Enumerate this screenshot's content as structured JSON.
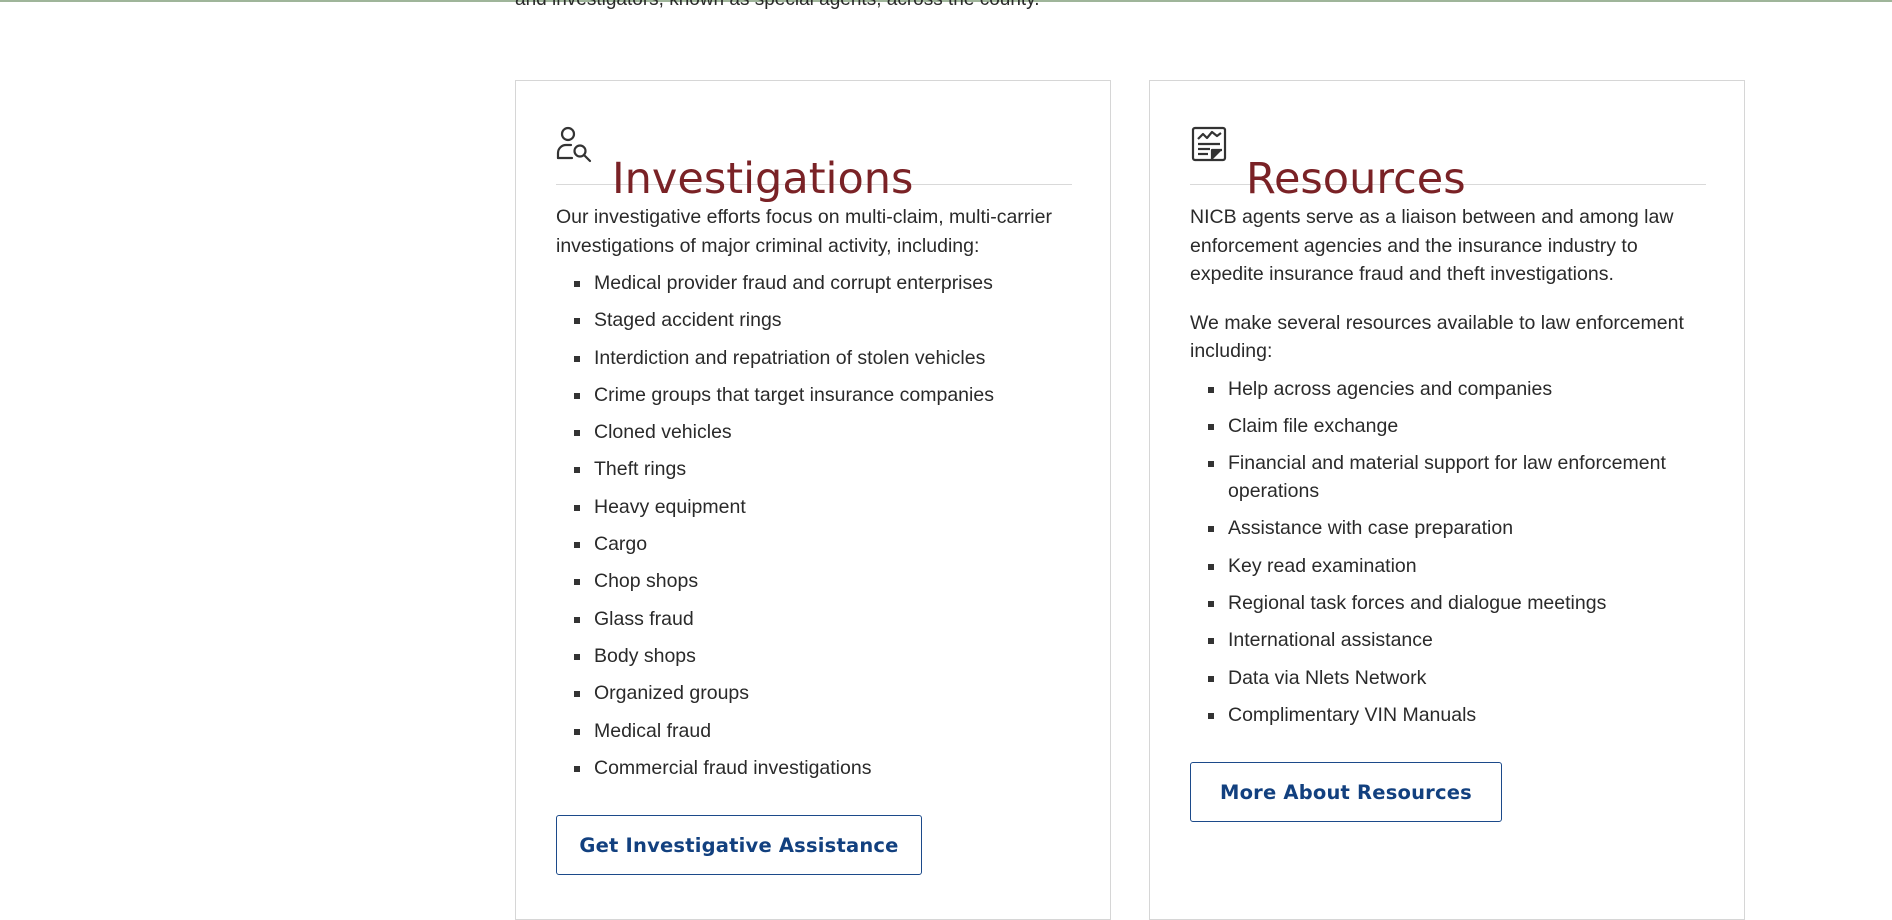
{
  "intro": {
    "text": "and investigators, known as special agents, across the county."
  },
  "investigations": {
    "icon": "person-search-icon",
    "title": "Investigations",
    "description": "Our investigative efforts focus on multi-claim, multi-carrier investigations of major criminal activity, including:",
    "items": [
      "Medical provider fraud and corrupt enterprises",
      "Staged accident rings",
      "Interdiction and repatriation of stolen vehicles",
      "Crime groups that target insurance companies",
      "Cloned vehicles",
      "Theft rings",
      "Heavy equipment",
      "Cargo",
      "Chop shops",
      "Glass fraud",
      "Body shops",
      "Organized groups",
      "Medical fraud",
      "Commercial fraud investigations"
    ],
    "button_label": "Get Investigative Assistance"
  },
  "resources": {
    "icon": "document-chart-icon",
    "title": "Resources",
    "description_1": "NICB agents serve as a liaison between and among law enforcement agencies and the insurance industry to expedite insurance fraud and theft investigations.",
    "description_2": "We make several resources available to law enforcement including:",
    "items": [
      "Help across agencies and companies",
      "Claim file exchange",
      "Financial and material support for law enforcement operations",
      "Assistance with case preparation",
      "Key read examination",
      "Regional task forces and dialogue meetings",
      "International assistance",
      "Data via Nlets Network",
      "Complimentary VIN Manuals"
    ],
    "button_label": "More About Resources"
  },
  "colors": {
    "title": "#7a2226",
    "button_text": "#12407f",
    "button_border": "#1c4a8a",
    "top_rule": "#9fb59a"
  }
}
